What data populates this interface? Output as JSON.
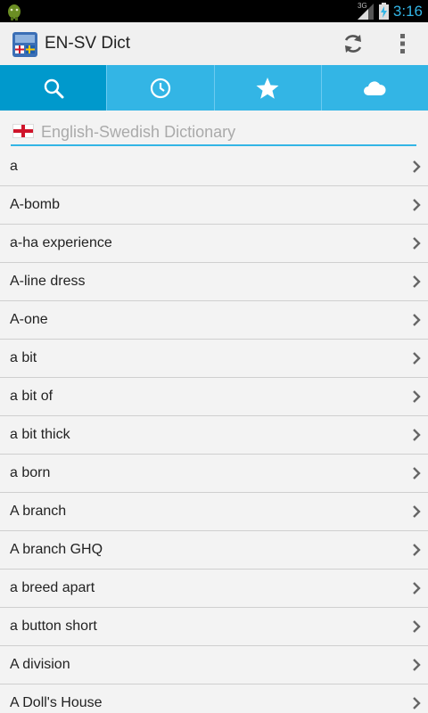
{
  "status_bar": {
    "network": "3G",
    "time": "3:16"
  },
  "action_bar": {
    "title": "EN-SV Dict",
    "app_icon": "dictionary-app-icon",
    "actions": [
      "refresh-icon",
      "overflow-menu-icon"
    ]
  },
  "tabs": [
    {
      "icon": "search-icon",
      "active": true
    },
    {
      "icon": "history-clock-icon",
      "active": false
    },
    {
      "icon": "favorites-star-icon",
      "active": false
    },
    {
      "icon": "cloud-icon",
      "active": false
    }
  ],
  "search": {
    "placeholder": "English-Swedish Dictionary",
    "value": ""
  },
  "words": [
    "a",
    "A-bomb",
    "a-ha experience",
    "A-line dress",
    "A-one",
    "a bit",
    "a bit of",
    "a bit thick",
    "a born",
    "A branch",
    "A branch GHQ",
    "a breed apart",
    "a button short",
    "A division",
    "A Doll's House"
  ],
  "colors": {
    "accent": "#33b5e5",
    "accent_dark": "#0099cc",
    "status_bar": "#000000",
    "background": "#f3f3f3"
  }
}
